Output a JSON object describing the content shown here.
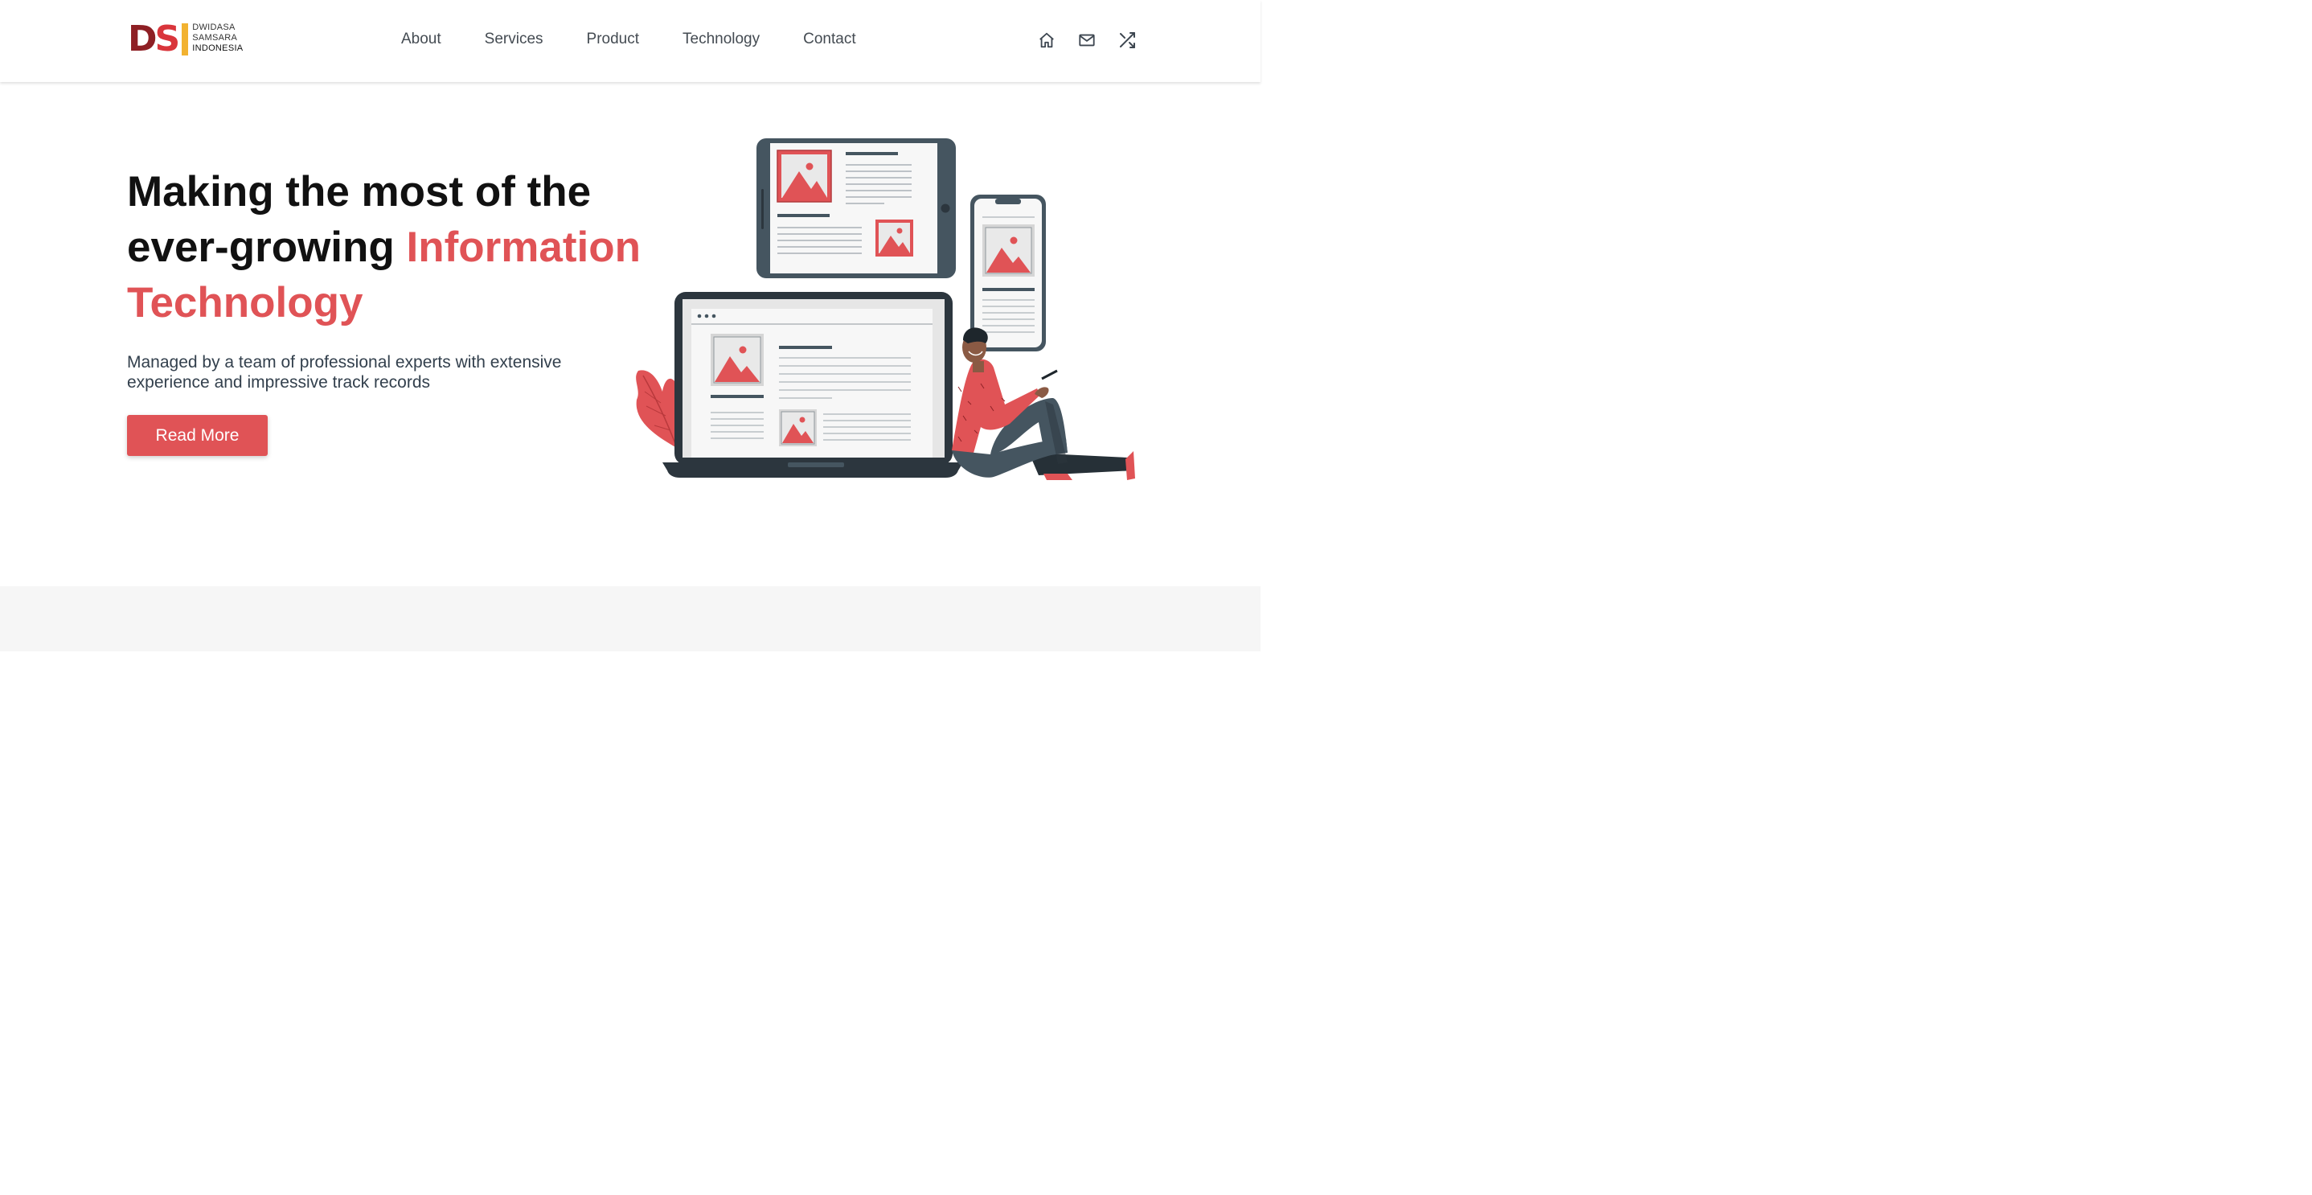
{
  "header": {
    "logo": {
      "mark_d": "D",
      "mark_s": "S",
      "mark_i": "I",
      "line1": "DWIDASA",
      "line2": "SAMSARA",
      "line3": "INDONESIA"
    },
    "nav": [
      {
        "label": "About"
      },
      {
        "label": "Services"
      },
      {
        "label": "Product"
      },
      {
        "label": "Technology"
      },
      {
        "label": "Contact"
      }
    ],
    "icons": [
      "home-icon",
      "mail-icon",
      "shuffle-icon"
    ]
  },
  "hero": {
    "title_line1": "Making the most of the",
    "title_line2_plain": "ever-growing ",
    "title_line2_accent": "Information",
    "title_line3_accent": "Technology",
    "subtitle": "Managed by a team of professional experts with extensive experience and impressive track records",
    "button_label": "Read More"
  },
  "colors": {
    "accent": "#e05356",
    "logo_dark_red": "#8e1f24",
    "logo_red": "#d9353b",
    "logo_yellow": "#f2b230",
    "device_frame": "#455560",
    "footer_band": "#f6f6f6"
  }
}
